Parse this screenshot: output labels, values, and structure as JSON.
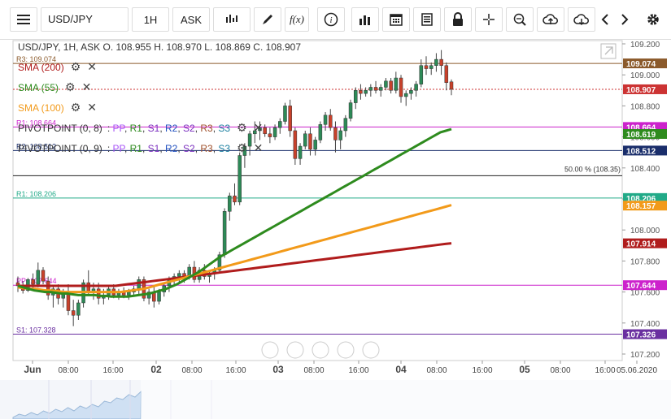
{
  "toolbar": {
    "menu_icon": "hamburger-icon",
    "symbol": "USD/JPY",
    "interval": "1H",
    "price_type": "ASK",
    "buttons": [
      "candles-icon",
      "draw-pen-icon",
      "fx-icon",
      "info-icon",
      "bar-chart-icon",
      "calendar-icon",
      "doc-icon",
      "lock-icon",
      "crosshair-icon",
      "zoom-icon",
      "cloud-upload-icon",
      "cloud-download-icon",
      "chevron-left-icon",
      "chevron-right-icon",
      "gear-icon"
    ],
    "fx_label": "f(x)"
  },
  "header": {
    "ohlc": "USD/JPY, 1H, ASK   O. 108.955 H. 108.970 L. 108.869 C. 108.907"
  },
  "indicators": [
    {
      "label": "SMA (200)",
      "color": "#b01c1c"
    },
    {
      "label": "SMA (55)",
      "color": "#2e8b1e"
    },
    {
      "label": "SMA (100)",
      "color": "#f29a1a"
    }
  ],
  "pivots": [
    {
      "label": "PIVOTPOINT (0, 8)",
      "items": [
        "PP",
        "R1",
        "S1",
        "R2",
        "S2",
        "R3",
        "S3"
      ]
    },
    {
      "label": "PIVOTPOINT (0, 9)",
      "items": [
        "PP",
        "R1",
        "S1",
        "R2",
        "S2",
        "R3",
        "S3"
      ]
    }
  ],
  "pivot_colors": [
    "#a855f7",
    "#2e8b1e",
    "#7b2fbf",
    "#1f4fbf",
    "#7b2fbf",
    "#a0522d",
    "#1a7fa0"
  ],
  "line_labels": [
    {
      "text": "R3: 109.074"
    },
    {
      "text": "R1: 108.664"
    },
    {
      "text": "R2: 108.512"
    },
    {
      "text": "R1: 108.206"
    },
    {
      "text": "PP: 107.644"
    },
    {
      "text": "S1: 107.328"
    },
    {
      "text": "50.00 % (108.35)"
    }
  ],
  "chart_data": {
    "type": "candlestick",
    "symbol": "USD/JPY",
    "interval": "1H",
    "ylim": [
      107.2,
      109.2
    ],
    "y_ticks": [
      "109.200",
      "109.000",
      "108.800",
      "108.600",
      "108.400",
      "108.200",
      "108.000",
      "107.800",
      "107.600",
      "107.400",
      "107.200"
    ],
    "x_ticks": [
      {
        "label": "Jun",
        "bold": true
      },
      {
        "label": "08:00"
      },
      {
        "label": "16:00"
      },
      {
        "label": "02",
        "bold": true
      },
      {
        "label": "08:00"
      },
      {
        "label": "16:00"
      },
      {
        "label": "03",
        "bold": true
      },
      {
        "label": "08:00"
      },
      {
        "label": "16:00"
      },
      {
        "label": "04",
        "bold": true
      },
      {
        "label": "08:00"
      },
      {
        "label": "16:00"
      },
      {
        "label": "05",
        "bold": true
      },
      {
        "label": "08:00"
      },
      {
        "label": "16:00"
      },
      {
        "label": "05.06.2020"
      }
    ],
    "candles": [
      [
        107.66,
        107.7,
        107.6,
        107.64
      ],
      [
        107.64,
        107.67,
        107.59,
        107.61
      ],
      [
        107.61,
        107.69,
        107.6,
        107.68
      ],
      [
        107.68,
        107.72,
        107.62,
        107.65
      ],
      [
        107.65,
        107.79,
        107.63,
        107.74
      ],
      [
        107.74,
        107.76,
        107.65,
        107.67
      ],
      [
        107.67,
        107.7,
        107.55,
        107.58
      ],
      [
        107.58,
        107.64,
        107.5,
        107.62
      ],
      [
        107.62,
        107.65,
        107.52,
        107.56
      ],
      [
        107.56,
        107.62,
        107.5,
        107.6
      ],
      [
        107.6,
        107.65,
        107.45,
        107.48
      ],
      [
        107.48,
        107.55,
        107.38,
        107.45
      ],
      [
        107.45,
        107.55,
        107.42,
        107.53
      ],
      [
        107.53,
        107.68,
        107.5,
        107.66
      ],
      [
        107.66,
        107.74,
        107.58,
        107.6
      ],
      [
        107.6,
        107.66,
        107.55,
        107.62
      ],
      [
        107.62,
        107.66,
        107.52,
        107.56
      ],
      [
        107.56,
        107.62,
        107.52,
        107.58
      ],
      [
        107.58,
        107.64,
        107.55,
        107.62
      ],
      [
        107.62,
        107.65,
        107.56,
        107.58
      ],
      [
        107.58,
        107.62,
        107.55,
        107.6
      ],
      [
        107.6,
        107.63,
        107.56,
        107.58
      ],
      [
        107.58,
        107.62,
        107.55,
        107.6
      ],
      [
        107.6,
        107.64,
        107.57,
        107.62
      ],
      [
        107.62,
        107.7,
        107.58,
        107.68
      ],
      [
        107.68,
        107.7,
        107.54,
        107.56
      ],
      [
        107.56,
        107.62,
        107.52,
        107.6
      ],
      [
        107.6,
        107.64,
        107.5,
        107.54
      ],
      [
        107.54,
        107.62,
        107.52,
        107.6
      ],
      [
        107.6,
        107.66,
        107.57,
        107.64
      ],
      [
        107.64,
        107.7,
        107.6,
        107.68
      ],
      [
        107.68,
        107.72,
        107.64,
        107.7
      ],
      [
        107.7,
        107.74,
        107.66,
        107.72
      ],
      [
        107.72,
        107.74,
        107.66,
        107.7
      ],
      [
        107.7,
        107.78,
        107.68,
        107.76
      ],
      [
        107.76,
        107.8,
        107.66,
        107.68
      ],
      [
        107.68,
        107.76,
        107.66,
        107.74
      ],
      [
        107.74,
        107.78,
        107.68,
        107.7
      ],
      [
        107.7,
        107.74,
        107.66,
        107.72
      ],
      [
        107.72,
        107.76,
        107.68,
        107.74
      ],
      [
        107.74,
        107.86,
        107.72,
        107.84
      ],
      [
        107.84,
        108.14,
        107.82,
        108.12
      ],
      [
        108.12,
        108.24,
        108.06,
        108.22
      ],
      [
        108.22,
        108.3,
        108.16,
        108.18
      ],
      [
        108.18,
        108.5,
        108.16,
        108.48
      ],
      [
        108.48,
        108.56,
        108.4,
        108.54
      ],
      [
        108.54,
        108.64,
        108.48,
        108.62
      ],
      [
        108.62,
        108.7,
        108.56,
        108.64
      ],
      [
        108.64,
        108.7,
        108.58,
        108.66
      ],
      [
        108.66,
        108.68,
        108.6,
        108.62
      ],
      [
        108.62,
        108.66,
        108.56,
        108.6
      ],
      [
        108.6,
        108.68,
        108.58,
        108.66
      ],
      [
        108.66,
        108.72,
        108.62,
        108.7
      ],
      [
        108.7,
        108.82,
        108.68,
        108.8
      ],
      [
        108.8,
        108.84,
        108.6,
        108.64
      ],
      [
        108.64,
        108.66,
        108.42,
        108.46
      ],
      [
        108.46,
        108.56,
        108.42,
        108.54
      ],
      [
        108.54,
        108.64,
        108.52,
        108.62
      ],
      [
        108.62,
        108.66,
        108.48,
        108.52
      ],
      [
        108.52,
        108.6,
        108.48,
        108.58
      ],
      [
        108.58,
        108.7,
        108.56,
        108.68
      ],
      [
        108.68,
        108.76,
        108.64,
        108.74
      ],
      [
        108.74,
        108.78,
        108.64,
        108.66
      ],
      [
        108.66,
        108.7,
        108.5,
        108.58
      ],
      [
        108.58,
        108.66,
        108.52,
        108.64
      ],
      [
        108.64,
        108.74,
        108.6,
        108.72
      ],
      [
        108.72,
        108.84,
        108.7,
        108.82
      ],
      [
        108.82,
        108.92,
        108.78,
        108.9
      ],
      [
        108.9,
        108.94,
        108.84,
        108.88
      ],
      [
        108.88,
        108.92,
        108.86,
        108.9
      ],
      [
        108.9,
        108.94,
        108.86,
        108.92
      ],
      [
        108.92,
        108.96,
        108.88,
        108.9
      ],
      [
        108.9,
        108.94,
        108.86,
        108.92
      ],
      [
        108.92,
        108.98,
        108.9,
        108.96
      ],
      [
        108.96,
        108.98,
        108.88,
        108.9
      ],
      [
        108.9,
        109.02,
        108.88,
        108.98
      ],
      [
        108.98,
        109.0,
        108.82,
        108.86
      ],
      [
        108.86,
        108.9,
        108.8,
        108.88
      ],
      [
        108.88,
        108.92,
        108.84,
        108.9
      ],
      [
        108.9,
        108.96,
        108.86,
        108.94
      ],
      [
        108.94,
        109.1,
        108.92,
        109.06
      ],
      [
        109.06,
        109.12,
        109.0,
        109.04
      ],
      [
        109.04,
        109.08,
        109.0,
        109.06
      ],
      [
        109.06,
        109.14,
        109.02,
        109.1
      ],
      [
        109.1,
        109.16,
        109.0,
        109.06
      ],
      [
        109.06,
        109.08,
        108.9,
        108.95
      ],
      [
        108.955,
        108.97,
        108.869,
        108.907
      ]
    ],
    "sma55": [
      107.64,
      107.63,
      107.62,
      107.61,
      107.605,
      107.6,
      107.6,
      107.595,
      107.59,
      107.59,
      107.585,
      107.58,
      107.58,
      107.58,
      107.58,
      107.575,
      107.575,
      107.57,
      107.57,
      107.57,
      107.57,
      107.575,
      107.58,
      107.585,
      107.59,
      107.6,
      107.61,
      107.62,
      107.635,
      107.65,
      107.67,
      107.69,
      107.71,
      107.73,
      107.755,
      107.78,
      107.805,
      107.83,
      107.85,
      107.87,
      107.89,
      107.91,
      107.93,
      107.95,
      107.97,
      107.99,
      108.01,
      108.03,
      108.05,
      108.07,
      108.09,
      108.11,
      108.13,
      108.15,
      108.17,
      108.19,
      108.21,
      108.23,
      108.25,
      108.27,
      108.29,
      108.31,
      108.33,
      108.35,
      108.37,
      108.39,
      108.41,
      108.43,
      108.45,
      108.47,
      108.49,
      108.51,
      108.53,
      108.55,
      108.57,
      108.59,
      108.61,
      108.63,
      108.64,
      108.65
    ],
    "sma100": [
      107.63,
      107.625,
      107.62,
      107.62,
      107.615,
      107.61,
      107.61,
      107.605,
      107.6,
      107.6,
      107.6,
      107.6,
      107.6,
      107.6,
      107.6,
      107.6,
      107.6,
      107.6,
      107.6,
      107.605,
      107.61,
      107.615,
      107.62,
      107.63,
      107.64,
      107.65,
      107.66,
      107.67,
      107.68,
      107.69,
      107.7,
      107.71,
      107.72,
      107.73,
      107.74,
      107.75,
      107.76,
      107.77,
      107.78,
      107.79,
      107.8,
      107.81,
      107.82,
      107.83,
      107.84,
      107.85,
      107.86,
      107.87,
      107.88,
      107.89,
      107.9,
      107.91,
      107.92,
      107.93,
      107.94,
      107.95,
      107.96,
      107.97,
      107.98,
      107.99,
      108.0,
      108.01,
      108.02,
      108.03,
      108.04,
      108.05,
      108.06,
      108.07,
      108.08,
      108.09,
      108.1,
      108.11,
      108.12,
      108.13,
      108.14,
      108.15,
      108.16
    ],
    "sma200": [
      107.64,
      107.64,
      107.64,
      107.64,
      107.64,
      107.64,
      107.64,
      107.64,
      107.64,
      107.64,
      107.64,
      107.64,
      107.64,
      107.64,
      107.64,
      107.64,
      107.64,
      107.645,
      107.65,
      107.655,
      107.66,
      107.665,
      107.67,
      107.675,
      107.68,
      107.685,
      107.69,
      107.695,
      107.7,
      107.705,
      107.71,
      107.715,
      107.72,
      107.725,
      107.73,
      107.735,
      107.74,
      107.745,
      107.75,
      107.755,
      107.76,
      107.765,
      107.77,
      107.775,
      107.78,
      107.785,
      107.79,
      107.795,
      107.8,
      107.805,
      107.81,
      107.815,
      107.82,
      107.825,
      107.83,
      107.835,
      107.84,
      107.845,
      107.85,
      107.855,
      107.86,
      107.865,
      107.87,
      107.875,
      107.88,
      107.885,
      107.89,
      107.895,
      107.9,
      107.905,
      107.91,
      107.914
    ],
    "hlines": [
      {
        "value": 109.074,
        "color": "#8b5a2b",
        "label": "109.074",
        "style": "solid"
      },
      {
        "value": 108.907,
        "color": "#cc3333",
        "label": "108.907",
        "style": "dashed"
      },
      {
        "value": 108.664,
        "color": "#cc22cc",
        "label": "108.664",
        "style": "solid"
      },
      {
        "value": 108.619,
        "color": "#2e8b1e",
        "label": "108.619",
        "style": "none"
      },
      {
        "value": 108.512,
        "color": "#1a2e6b",
        "label": "108.512",
        "style": "solid"
      },
      {
        "value": 108.35,
        "color": "#222222",
        "label": "",
        "style": "solid"
      },
      {
        "value": 108.206,
        "color": "#22aa88",
        "label": "108.206",
        "style": "solid"
      },
      {
        "value": 108.157,
        "color": "#f29a1a",
        "label": "108.157",
        "style": "none"
      },
      {
        "value": 107.914,
        "color": "#b01c1c",
        "label": "107.914",
        "style": "none"
      },
      {
        "value": 107.644,
        "color": "#cc22cc",
        "label": "107.644",
        "style": "solid"
      },
      {
        "value": 107.328,
        "color": "#6a2fa0",
        "label": "107.326",
        "style": "solid"
      }
    ]
  },
  "navigator": {
    "controls": [
      "scroll-left-icon",
      "zoom-out-icon",
      "reset-icon",
      "zoom-in-icon",
      "scroll-right-icon"
    ]
  }
}
